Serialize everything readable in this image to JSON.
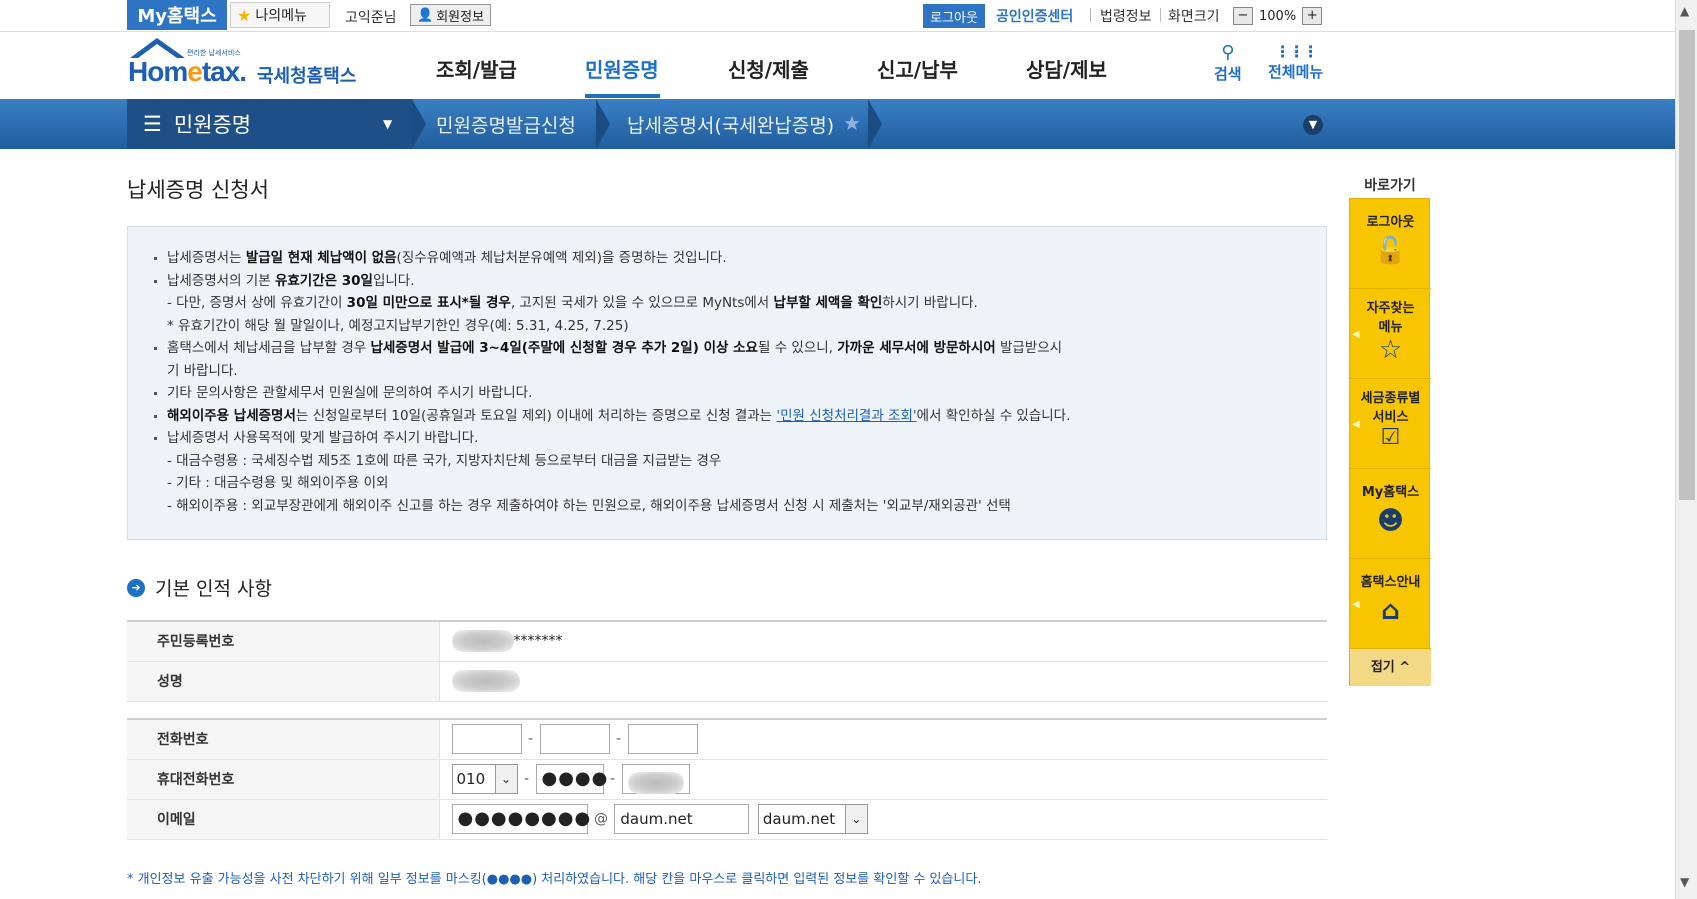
{
  "topbar": {
    "my_hometax": "My홈택스",
    "my_menu": "나의메뉴",
    "user_name": "고익준님",
    "member_info": "회원정보",
    "logout": "로그아웃",
    "cert_center": "공인인증센터",
    "law_info": "법령정보",
    "screen_size": "화면크기",
    "zoom_minus": "−",
    "zoom_level": "100%",
    "zoom_plus": "+"
  },
  "header": {
    "logo_text_a": "Hom",
    "logo_text_e": "e",
    "logo_text_b": "tax.",
    "logo_kr": "국세청홈택스",
    "logo_small": "편리한 납세서비스",
    "nav": [
      "조회/발급",
      "민원증명",
      "신청/제출",
      "신고/납부",
      "상담/제보"
    ],
    "search_label": "검색",
    "all_menu_label": "전체메뉴"
  },
  "location": {
    "home": "민원증명",
    "item1": "민원증명발급신청",
    "item2": "납세증명서(국세완납증명)"
  },
  "page_title": "납세증명 신청서",
  "info": {
    "l1a": "납세증명서는 ",
    "l1b": "발급일 현재 체납액이 없음",
    "l1c": "(징수유예액과 체납처분유예액 제외)을 증명하는 것입니다.",
    "l2a": "납세증명서의 기본 ",
    "l2b": "유효기간은 30일",
    "l2c": "입니다.",
    "l3a": "- 다만, 증명서 상에 유효기간이 ",
    "l3b": "30일 미만으로 표시*될 경우",
    "l3c": ", 고지된 국세가 있을 수 있으므로 MyNts에서 ",
    "l3d": "납부할 세액을 확인",
    "l3e": "하시기 바랍니다.",
    "l4": "* 유효기간이 해당 월 말일이나, 예정고지납부기한인 경우(예: 5.31, 4.25, 7.25)",
    "l5a": "홈택스에서 체납세금을 납부할 경우 ",
    "l5b": "납세증명서 발급에 3~4일(주말에 신청할 경우 추가 2일) 이상 소요",
    "l5c": "될 수 있으니, ",
    "l5d": "가까운 세무서에 방문하시어",
    "l5e": " 발급받으시",
    "l6": "기 바랍니다.",
    "l7": "기타 문의사항은 관할세무서 민원실에 문의하여 주시기 바랍니다.",
    "l8a": "해외이주용 납세증명서",
    "l8b": "는 신청일로부터 10일(공휴일과 토요일 제외) 이내에 처리하는 증명으로 신청 결과는 ",
    "l8c": "'민원 신청처리결과 조회'",
    "l8d": "에서 확인하실 수 있습니다.",
    "l9": "납세증명서 사용목적에 맞게 발급하여 주시기 바랍니다.",
    "l10": "- 대금수령용 : 국세징수법 제5조 1호에 따른 국가, 지방자치단체 등으로부터 대금을 지급받는 경우",
    "l11": "- 기타 : 대금수령용 및 해외이주용 이외",
    "l12": "- 해외이주용 : 외교부장관에게 해외이주 신고를 하는 경우 제출하여야 하는 민원으로, 해외이주용 납세증명서 신청 시 제출처는 '외교부/재외공관' 선택"
  },
  "section_title": "기본 인적 사항",
  "form": {
    "rrn_label": "주민등록번호",
    "rrn_masked": "*******",
    "name_label": "성명",
    "phone_label": "전화번호",
    "mobile_label": "휴대전화번호",
    "mobile_prefix": "010",
    "mobile_mid": "●●●●",
    "email_label": "이메일",
    "email_id": "●●●●●●●●",
    "at": "@",
    "email_domain": "daum.net",
    "email_domain_select": "daum.net",
    "dash": "-"
  },
  "note": "* 개인정보 유출 가능성을 사전 차단하기 위해 일부 정보를 마스킹(●●●●) 처리하였습니다. 해당 칸을 마우스로 클릭하면 입력된 정보를 확인할 수 있습니다.",
  "quick": {
    "title": "바로가기",
    "logout": "로그아웃",
    "faq1": "자주찾는",
    "faq2": "메뉴",
    "tax1": "세금종류별",
    "tax2": "서비스",
    "my": "My홈택스",
    "guide": "홈택스안내",
    "close": "접기 ^"
  }
}
